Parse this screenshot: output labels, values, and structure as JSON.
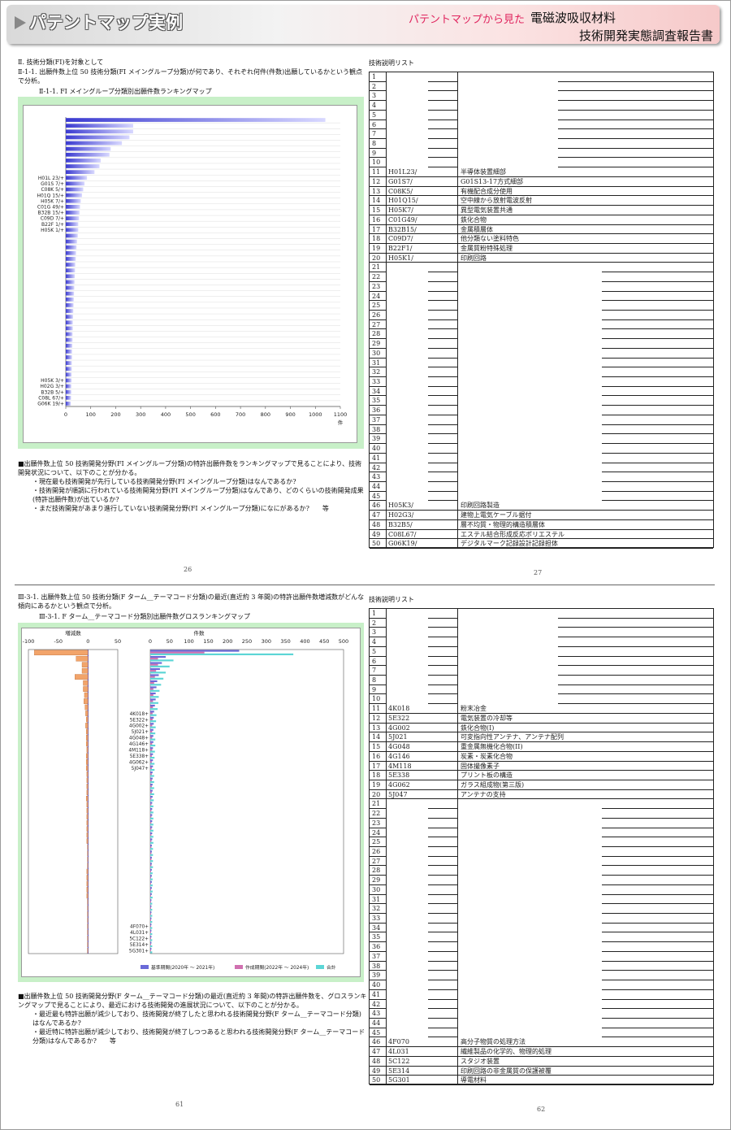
{
  "header": {
    "title": "パテントマップ実例",
    "subtitle_prefix": "パテントマップから見た",
    "subtitle_topic": "電磁波吸収材料",
    "report": "技術開発実態調査報告書"
  },
  "top": {
    "section": "Ⅱ. 技術分類(FI)を対象として",
    "heading": "Ⅱ-1-1. 出願件数上位 50 技術分類(FI メイングループ分類)が何であり、それぞれ何件(件数)出願しているかという観点で分析。",
    "chart_title": "Ⅱ-1-1. FI メイングループ分類別出願件数ランキングマップ",
    "notes": [
      "■出願件数上位 50 技術開発分野(FI メイングループ分類)の特許出願件数をランキングマップで見ることにより、技術開発状況について、以下のことが分かる。",
      "・現在最も技術開発が先行している技術開発分野(FI メイングループ分類)はなんであるか?",
      "・技術開発が順調に行われている技術開発分野(FI メイングループ分類)はなんであり、どのくらいの技術開発成果(特許出願件数)が出ているか?",
      "・まだ技術開発があまり進行していない技術開発分野(FI メイングループ分類)になにがあるか?　　等"
    ],
    "page_left": "26",
    "page_right": "27",
    "list_title": "技術説明リスト"
  },
  "bottom": {
    "heading": "Ⅲ-3-1. 出願件数上位 50 技術分類(F ターム__テーマコード分類)の最近(直近約 3 年間)の特許出願件数増減数がどんな傾向にあるかという観点で分析。",
    "chart_title": "Ⅲ-3-1. F ターム__テーマコード分類別出願件数グロスランキングマップ",
    "notes": [
      "■出願件数上位 50 技術開発分野(F ターム__テーマコード分類)の最近(直近約 3 年間)の特許出願件数を、グロスランキングマップで見ることにより、最近における技術開発の進展状況について、以下のことが分かる。",
      "・最近最も特許出願が減少しており、技術開発が終了したと思われる技術開発分野(F ターム__テーマコード分類)はなんであるか?",
      "・最近特に特許出願が減少しており、技術開発が終了しつつあると思われる技術開発分野(F ターム__テーマコード分類)はなんであるか?　　等"
    ],
    "page_left": "61",
    "page_right": "62",
    "list_title": "技術説明リスト"
  },
  "list1": [
    {
      "n": "11",
      "c": "H01L23/",
      "d": "半導体装置細部"
    },
    {
      "n": "12",
      "c": "G01S7/",
      "d": "G01S13-17方式細部"
    },
    {
      "n": "13",
      "c": "C08K5/",
      "d": "有機配合成分使用"
    },
    {
      "n": "14",
      "c": "H01Q15/",
      "d": "空中線から放射電波反射"
    },
    {
      "n": "15",
      "c": "H05K7/",
      "d": "異型電気装置共通"
    },
    {
      "n": "16",
      "c": "C01G49/",
      "d": "鉄化合物"
    },
    {
      "n": "17",
      "c": "B32B15/",
      "d": "金属積層体"
    },
    {
      "n": "18",
      "c": "C09D7/",
      "d": "他分類ない塗料特色"
    },
    {
      "n": "19",
      "c": "B22F1/",
      "d": "金属質粉特殊処理"
    },
    {
      "n": "20",
      "c": "H05K1/",
      "d": "印刷回路"
    },
    {
      "n": "46",
      "c": "H05K3/",
      "d": "印刷回路製造"
    },
    {
      "n": "47",
      "c": "H02G3/",
      "d": "建物上電気ケーブル据付"
    },
    {
      "n": "48",
      "c": "B32B5/",
      "d": "層不均質・物理的構造積層体"
    },
    {
      "n": "49",
      "c": "C08L67/",
      "d": "エステル結合形成反応ポリエステル"
    },
    {
      "n": "50",
      "c": "G06K19/",
      "d": "デジタルマーク記録設計記録担体"
    }
  ],
  "list2": [
    {
      "n": "11",
      "c": "4K018",
      "d": "粉末冶金"
    },
    {
      "n": "12",
      "c": "5E322",
      "d": "電気装置の冷却等"
    },
    {
      "n": "13",
      "c": "4G002",
      "d": "鉄化合物(I)"
    },
    {
      "n": "14",
      "c": "5J021",
      "d": "可変指向性アンテナ、アンテナ配列"
    },
    {
      "n": "15",
      "c": "4G048",
      "d": "重金属無機化合物(II)"
    },
    {
      "n": "16",
      "c": "4G146",
      "d": "炭素・炭素化合物"
    },
    {
      "n": "17",
      "c": "4M118",
      "d": "固体撮像素子"
    },
    {
      "n": "18",
      "c": "5E338",
      "d": "プリント板の構造"
    },
    {
      "n": "19",
      "c": "4G062",
      "d": "ガラス組成物(第三版)"
    },
    {
      "n": "20",
      "c": "5J047",
      "d": "アンテナの支持"
    },
    {
      "n": "46",
      "c": "4F070",
      "d": "高分子物質の処理方法"
    },
    {
      "n": "47",
      "c": "4L031",
      "d": "繊維製品の化学的、物理的処理"
    },
    {
      "n": "48",
      "c": "5C122",
      "d": "スタジオ装置"
    },
    {
      "n": "49",
      "c": "5E314",
      "d": "印刷回路の非金属質の保護被覆"
    },
    {
      "n": "50",
      "c": "5G301",
      "d": "導電材料"
    }
  ],
  "chart_data": [
    {
      "type": "bar",
      "orientation": "horizontal",
      "title": "",
      "xlabel": "件",
      "xlim": [
        0,
        1100
      ],
      "xticks": [
        "0",
        "100",
        "200",
        "300",
        "400",
        "500",
        "600",
        "700",
        "800",
        "900",
        "1000",
        "1100"
      ],
      "labels_top": [
        "H01L 23/+",
        "G01S 7/+",
        "C08K 5/+",
        "H01Q 15/+",
        "H05K 7/+",
        "C01G 49/+",
        "B32B 15/+",
        "C09D 7/+",
        "B22F 1/+",
        "H05K 1/+"
      ],
      "labels_bottom": [
        "H05K 3/+",
        "H02G 3/+",
        "B32B 5/+",
        "C08L 67/+",
        "G06K 19/+"
      ],
      "values": [
        1040,
        270,
        270,
        255,
        225,
        180,
        175,
        140,
        135,
        115,
        85,
        75,
        70,
        65,
        60,
        57,
        55,
        53,
        50,
        50,
        48,
        45,
        43,
        41,
        40,
        38,
        37,
        36,
        35,
        34,
        33,
        32,
        31,
        30,
        29,
        28,
        28,
        27,
        27,
        26,
        25,
        25,
        24,
        24,
        23,
        23,
        22,
        22,
        21,
        20
      ]
    },
    {
      "type": "bar",
      "orientation": "horizontal",
      "title": "",
      "xlabel": "件数",
      "left_xlabel": "増減数",
      "left_xticks": [
        "-100",
        "-50",
        "0",
        "50"
      ],
      "right_xticks": [
        "0",
        "50",
        "100",
        "150",
        "200",
        "250",
        "300",
        "350",
        "400",
        "450",
        "500"
      ],
      "legend": [
        "基準期間(2020年 ～ 2021年)",
        "作成期間(2022年 ～ 2024年)",
        "合計"
      ],
      "labels_top": [
        "4K018+",
        "5E322+",
        "4G002+",
        "5J021+",
        "4G048+",
        "4G146+",
        "4M118+",
        "5E338+",
        "4G062+",
        "5J047+"
      ],
      "labels_bottom": [
        "4F070+",
        "4L031+",
        "5C122+",
        "5E314+",
        "5G301+"
      ],
      "base": [
        230,
        40,
        30,
        25,
        22,
        18,
        16,
        14,
        14,
        12,
        10,
        9,
        9,
        8,
        8,
        8,
        7,
        7,
        7,
        7,
        6,
        6,
        6,
        6,
        6,
        5,
        5,
        5,
        5,
        5,
        5,
        5,
        4,
        4,
        4,
        4,
        4,
        4,
        4,
        4,
        4,
        3,
        3,
        3,
        3,
        3,
        3,
        3,
        3,
        3
      ],
      "recent": [
        140,
        20,
        20,
        15,
        12,
        10,
        8,
        8,
        7,
        7,
        6,
        6,
        5,
        5,
        5,
        5,
        5,
        4,
        4,
        4,
        4,
        4,
        4,
        4,
        3,
        3,
        3,
        3,
        3,
        3,
        3,
        3,
        3,
        3,
        3,
        3,
        2,
        2,
        2,
        2,
        2,
        2,
        2,
        2,
        2,
        2,
        2,
        2,
        2,
        2
      ],
      "delta": [
        -90,
        -20,
        -10,
        -10,
        -22,
        -8,
        -8,
        -6,
        -7,
        -5,
        -4,
        -3,
        -4,
        -3,
        -3,
        -3,
        -2,
        -3,
        -3,
        -3,
        -2,
        -2,
        -2,
        -2,
        -3,
        -2,
        -2,
        -2,
        -2,
        -2,
        -2,
        -2,
        -1,
        -1,
        -1,
        -1,
        -2,
        -2,
        -2,
        -2,
        -2,
        -1,
        -1,
        -1,
        -1,
        -1,
        -1,
        -1,
        -1,
        -1
      ]
    }
  ]
}
